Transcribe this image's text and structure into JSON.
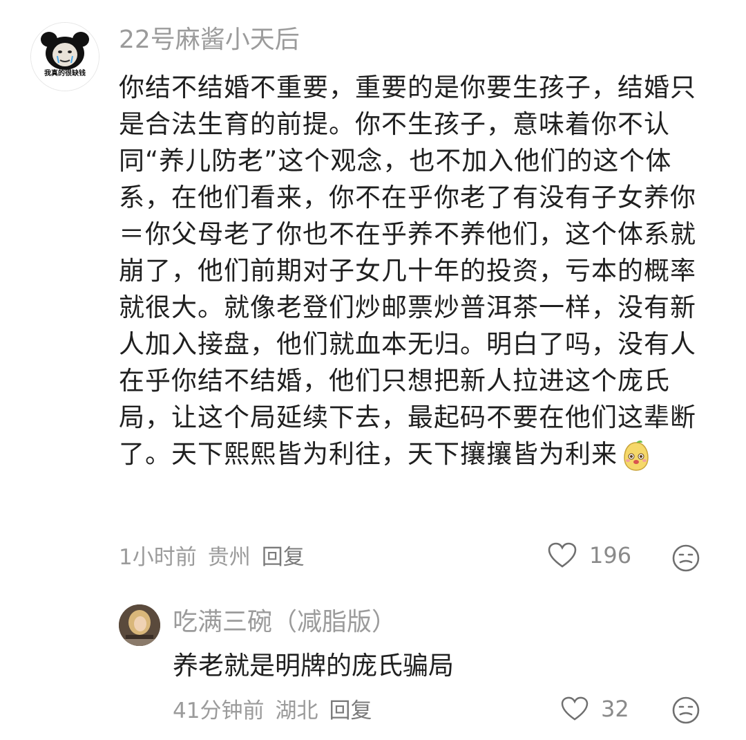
{
  "comment": {
    "username": "22号麻酱小天后",
    "avatar_caption": "我真的很缺钱",
    "text": "你结不结婚不重要，重要的是你要生孩子，结婚只是合法生育的前提。你不生孩子，意味着你不认同“养儿防老”这个观念，也不加入他们的这个体系，在他们看来，你不在乎你老了有没有子女养你＝你父母老了你也不在乎养不养他们，这个体系就崩了，他们前期对子女几十年的投资，亏本的概率就很大。就像老登们炒邮票炒普洱茶一样，没有新人加入接盘，他们就血本无归。明白了吗，没有人在乎你结不结婚，他们只想把新人拉进这个庞氏局，让这个局延续下去，最起码不要在他们这辈断了。天下熙熙皆为利往，天下攘攘皆为利来",
    "time": "1小时前",
    "location": "贵州",
    "reply_label": "回复",
    "likes": "196"
  },
  "reply": {
    "username": "吃满三碗（减脂版）",
    "text": "养老就是明牌的庞氏骗局",
    "time": "41分钟前",
    "location": "湖北",
    "reply_label": "回复",
    "likes": "32"
  }
}
